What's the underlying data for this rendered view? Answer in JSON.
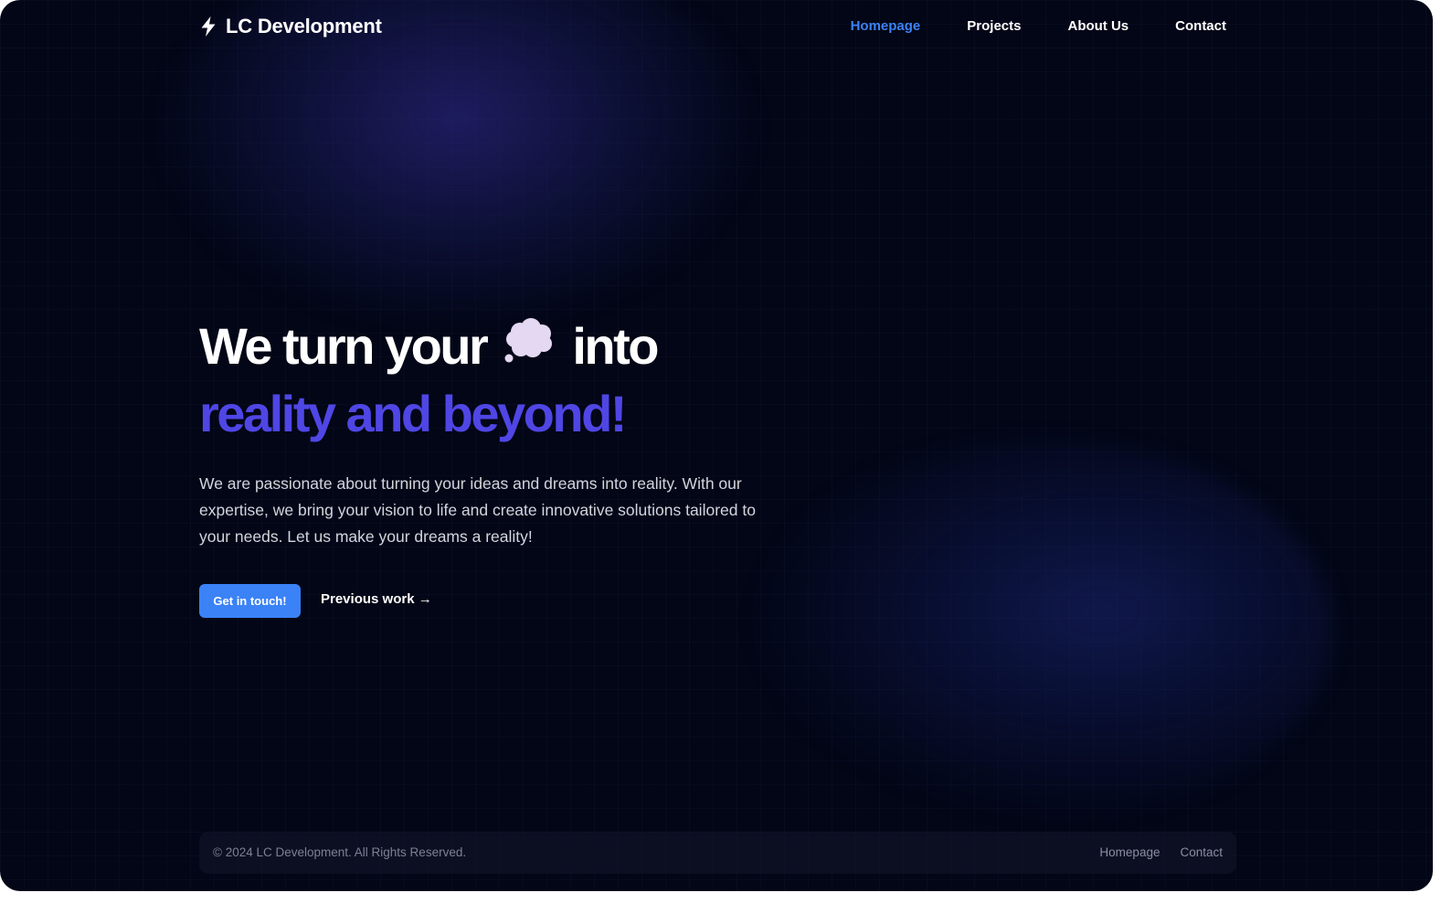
{
  "brand": {
    "name": "LC Development",
    "icon": "lightning-bolt-icon"
  },
  "nav": {
    "items": [
      {
        "label": "Homepage",
        "active": true
      },
      {
        "label": "Projects",
        "active": false
      },
      {
        "label": "About Us",
        "active": false
      },
      {
        "label": "Contact",
        "active": false
      }
    ]
  },
  "hero": {
    "headline_before": "We turn your",
    "headline_icon": "thought-cloud-icon",
    "headline_after": "into",
    "headline_accent": "reality and beyond!",
    "description": "We are passionate about turning your ideas and dreams into reality. With our expertise, we bring your vision to life and create innovative solutions tailored to your needs. Let us make your dreams a reality!",
    "primary_button": "Get in touch!",
    "secondary_link": "Previous work →"
  },
  "footer": {
    "copyright": "© 2024 LC Development. All Rights Reserved.",
    "links": [
      "Homepage",
      "Contact"
    ]
  },
  "colors": {
    "background": "#030616",
    "accent": "#3b82f6",
    "headline_accent": "#4f46e5",
    "text": "#ffffff"
  }
}
